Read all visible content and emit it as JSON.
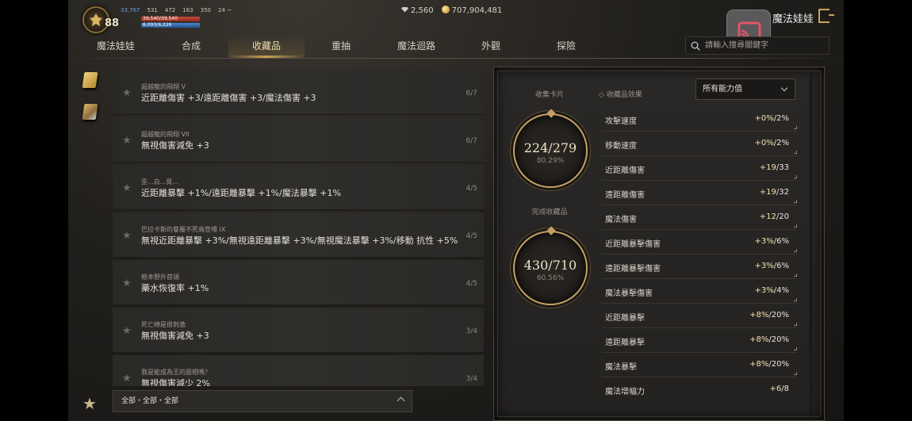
{
  "header": {
    "level": "88",
    "stats": [
      "33,767",
      "531",
      "472",
      "163",
      "350",
      "24 ~"
    ],
    "hp_text": "39,540/39,540",
    "mp_text": "6,093/6,226",
    "gems": "2,560",
    "gold": "707,904,481",
    "title": "魔法娃娃"
  },
  "tabs": [
    {
      "label": "魔法娃娃"
    },
    {
      "label": "合成"
    },
    {
      "label": "收藏品"
    },
    {
      "label": "重抽"
    },
    {
      "label": "魔法迴路"
    },
    {
      "label": "外觀"
    },
    {
      "label": "探險"
    }
  ],
  "search": {
    "placeholder": "請輸入搜尋關鍵字"
  },
  "items": [
    {
      "sub": "超越龍的飛翔 V",
      "main": "近距離傷害 +3/遠距離傷害 +3/魔法傷害 +3",
      "progress": "6/7"
    },
    {
      "sub": "超越龍的飛翔 VII",
      "main": "無視傷害減免 +3",
      "progress": "6/7"
    },
    {
      "sub": "歪...白...買...",
      "main": "近距離暴擊 +1%/遠距離暴擊 +1%/魔法暴擊 +1%",
      "progress": "4/5"
    },
    {
      "sub": "巴拉卡斯的眷屬不死鳥登場 IX",
      "main": "無視近距離暴擊 +3%/無視遠距離暴擊 +3%/無視魔法暴擊 +3%/移動 抗性 +5%",
      "progress": "4/5"
    },
    {
      "sub": "根本野外首領",
      "main": "藥水恢復率 +1%",
      "progress": "4/5"
    },
    {
      "sub": "死亡總是很刺激",
      "main": "無視傷害減免 +3",
      "progress": "3/4"
    },
    {
      "sub": "我是能成為王的面相嗎？",
      "main": "無視傷害減少 2%",
      "progress": "3/4"
    }
  ],
  "filter": {
    "label": "全部・全部・全部"
  },
  "collection": {
    "cards_label": "收集卡片",
    "cards_value": "224",
    "cards_total": "/279",
    "cards_pct": "80.29%",
    "done_label": "完成收藏品",
    "done_value": "430",
    "done_total": "/710",
    "done_pct": "60.56%"
  },
  "effects": {
    "label": "◇ 收藏品效果",
    "dropdown": "所有能力值",
    "rows": [
      {
        "name": "攻擊速度",
        "value": "+0%",
        "max": "/2%"
      },
      {
        "name": "移動速度",
        "value": "+0%",
        "max": "/2%"
      },
      {
        "name": "近距離傷害",
        "value": "+19",
        "max": "/33"
      },
      {
        "name": "遠距離傷害",
        "value": "+19",
        "max": "/32"
      },
      {
        "name": "魔法傷害",
        "value": "+12",
        "max": "/20"
      },
      {
        "name": "近距離暴擊傷害",
        "value": "+3%",
        "max": "/6%"
      },
      {
        "name": "遠距離暴擊傷害",
        "value": "+3%",
        "max": "/6%"
      },
      {
        "name": "魔法暴擊傷害",
        "value": "+3%",
        "max": "/4%"
      },
      {
        "name": "近距離暴擊",
        "value": "+8%",
        "max": "/20%"
      },
      {
        "name": "遠距離暴擊",
        "value": "+8%",
        "max": "/20%"
      },
      {
        "name": "魔法暴擊",
        "value": "+8%",
        "max": "/20%"
      },
      {
        "name": "魔法增幅力",
        "value": "+6",
        "max": "/8"
      }
    ]
  }
}
